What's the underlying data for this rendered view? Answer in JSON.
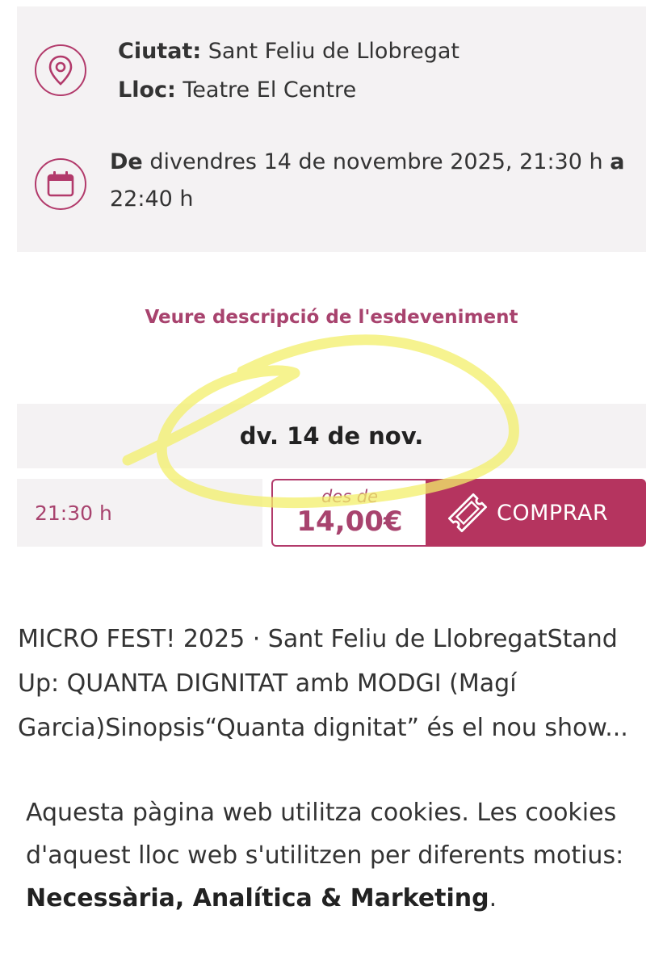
{
  "location": {
    "city_label": "Ciutat:",
    "city_value": "Sant Feliu de Llobregat",
    "venue_label": "Lloc:",
    "venue_value": "Teatre El Centre",
    "icon": "map-pin-icon"
  },
  "schedule": {
    "from_label": "De",
    "from_value": "divendres 14 de novembre 2025, 21:30 h",
    "to_label": "a",
    "to_value": "22:40 h",
    "icon": "calendar-icon"
  },
  "description_link": "Veure descripció de l'esdeveniment",
  "session": {
    "day_label": "dv. 14 de nov.",
    "time": "21:30 h",
    "price_from": "des de",
    "price": "14,00€",
    "buy_label": "COMPRAR",
    "buy_icon": "ticket-icon"
  },
  "event_summary": "MICRO FEST! 2025 · Sant Feliu de LlobregatStand Up: QUANTA DIGNITAT amb MODGI (Magí Garcia)Sinopsis“Quanta dignitat” és el nou show...",
  "cookies": {
    "text_before": "Aquesta pàgina web utilitza cookies. Les cookies d'aquest lloc web s'utilitzen per diferents motius: ",
    "bold_categories": "Necessària, Analítica & Marketing",
    "text_after": "."
  },
  "colors": {
    "accent": "#b5345f",
    "accent_text": "#a8436e",
    "card_bg": "#f4f2f3",
    "highlight": "#f3ef6a"
  }
}
